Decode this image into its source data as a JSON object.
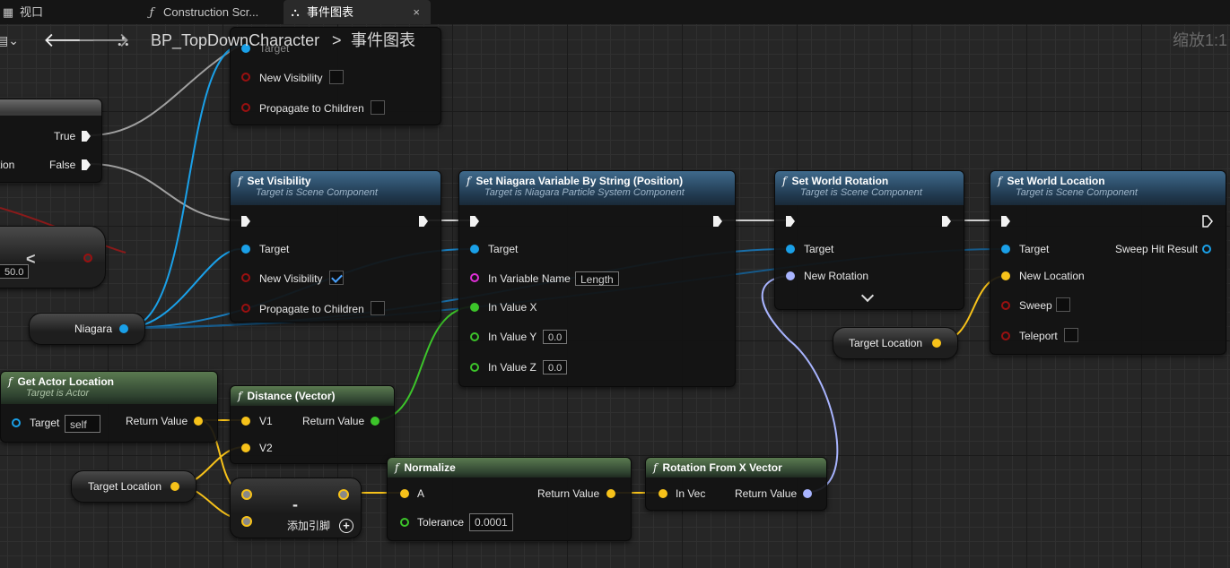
{
  "tabs": [
    {
      "label": "视口",
      "icon": "viewport-icon"
    },
    {
      "label": "Construction Scr...",
      "icon": "function-icon"
    },
    {
      "label": "事件图表",
      "icon": "event-graph-icon",
      "close": "×"
    }
  ],
  "toolbar": {
    "breadcrumb_blueprint": "BP_TopDownCharacter",
    "breadcrumb_separator": ">",
    "breadcrumb_graph": "事件图表",
    "zoom": "缩放1:1"
  },
  "branch_node": {
    "true_label": "True",
    "false_label": "False",
    "condition_partial": "tion"
  },
  "compare_node": {
    "value": "50.0",
    "op": "<"
  },
  "top_visibility_node": {
    "target": "Target",
    "new_visibility": "New Visibility",
    "propagate": "Propagate to Children"
  },
  "set_visibility": {
    "title": "Set Visibility",
    "subtitle": "Target is Scene Component",
    "target": "Target",
    "new_visibility": "New Visibility",
    "propagate": "Propagate to Children"
  },
  "set_niagara": {
    "title": "Set Niagara Variable By String (Position)",
    "subtitle": "Target is Niagara Particle System Component",
    "target": "Target",
    "in_variable_name": "In Variable Name",
    "variable_name_value": "Length",
    "in_value_x": "In Value X",
    "in_value_y": "In Value Y",
    "in_value_y_val": "0.0",
    "in_value_z": "In Value Z",
    "in_value_z_val": "0.0"
  },
  "set_world_rotation": {
    "title": "Set World Rotation",
    "subtitle": "Target is Scene Component",
    "target": "Target",
    "new_rotation": "New Rotation"
  },
  "set_world_location": {
    "title": "Set World Location",
    "subtitle": "Target is Scene Component",
    "target": "Target",
    "sweep_hit_result": "Sweep Hit Result",
    "new_location": "New Location",
    "sweep": "Sweep",
    "teleport": "Teleport"
  },
  "niagara_var": {
    "label": "Niagara"
  },
  "target_location_var_1": {
    "label": "Target Location"
  },
  "target_location_var_2": {
    "label": "Target Location"
  },
  "get_actor_location": {
    "title": "Get Actor Location",
    "subtitle": "Target is Actor",
    "target": "Target",
    "self_value": "self",
    "return_value": "Return Value"
  },
  "distance": {
    "title": "Distance (Vector)",
    "v1": "V1",
    "v2": "V2",
    "return_value": "Return Value"
  },
  "subtract": {
    "symbol": "-",
    "add_pin": "添加引脚"
  },
  "normalize": {
    "title": "Normalize",
    "a": "A",
    "return_value": "Return Value",
    "tolerance": "Tolerance",
    "tolerance_value": "0.0001"
  },
  "rotation_from_x": {
    "title": "Rotation From X Vector",
    "in_vec": "In Vec",
    "return_value": "Return Value"
  },
  "colors": {
    "exec": "#f2f2f2",
    "object": "#1aa0e8",
    "bool": "#9a1010",
    "string": "#e02fd8",
    "float": "#3cc42a",
    "vector": "#f7c21a",
    "rotator": "#a8b4ff",
    "background": "#262626"
  }
}
